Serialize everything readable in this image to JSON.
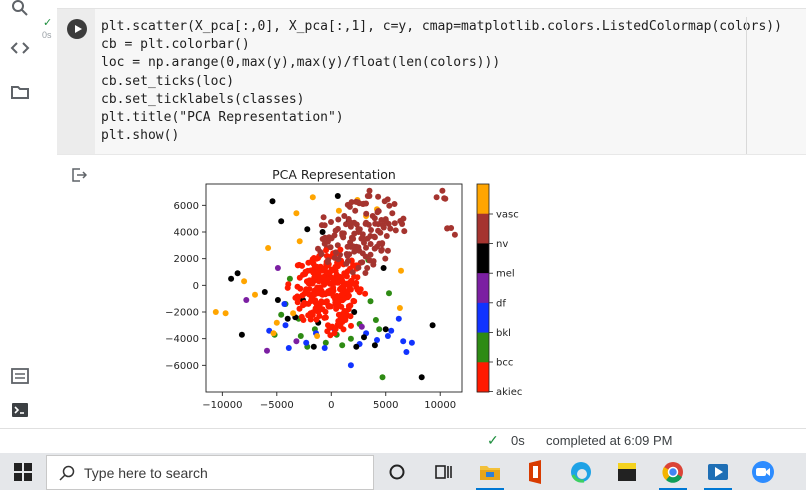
{
  "code_cell": {
    "exec_time": "0s",
    "lines": [
      "plt.scatter(X_pca[:,0], X_pca[:,1], c=y, cmap=matplotlib.colors.ListedColormap(colors))",
      "cb = plt.colorbar()",
      "loc = np.arange(0,max(y),max(y)/float(len(colors)))",
      "cb.set_ticks(loc)",
      "cb.set_ticklabels(classes)",
      "plt.title(\"PCA Representation\")",
      "plt.show()"
    ]
  },
  "status_bar": {
    "time": "0s",
    "message": "completed at 6:09 PM"
  },
  "taskbar": {
    "search_placeholder": "Type here to search",
    "apps": [
      "cortana-icon",
      "task-view-icon",
      "file-explorer-icon",
      "office-icon",
      "edge-icon",
      "sticky-notes-icon",
      "chrome-icon",
      "video-editor-icon",
      "zoom-icon"
    ]
  },
  "colors": {
    "akiec": "#ff1a00",
    "bcc": "#2e8b14",
    "bkl": "#1133ff",
    "df": "#7b1fa2",
    "mel": "#000000",
    "nv": "#a5342f",
    "vasc": "#ffa500"
  },
  "chart_data": {
    "type": "scatter",
    "title": "PCA Representation",
    "xlabel": "",
    "ylabel": "",
    "xlim": [
      -11500,
      12000
    ],
    "ylim": [
      -8000,
      7600
    ],
    "xticks": [
      "−10000",
      "−5000",
      "0",
      "5000",
      "10000"
    ],
    "xtick_values": [
      -10000,
      -5000,
      0,
      5000,
      10000
    ],
    "yticks": [
      "6000",
      "4000",
      "2000",
      "0",
      "−2000",
      "−4000",
      "−6000"
    ],
    "ytick_values": [
      6000,
      4000,
      2000,
      0,
      -2000,
      -4000,
      -6000
    ],
    "colorbar": {
      "labels": [
        "vasc",
        "nv",
        "mel",
        "df",
        "bkl",
        "bcc",
        "akiec"
      ],
      "colors": [
        "#ffa500",
        "#a5342f",
        "#000000",
        "#7b1fa2",
        "#1133ff",
        "#2e8b14",
        "#ff1a00"
      ]
    },
    "series": [
      {
        "name": "akiec",
        "points": [
          [
            -1500,
            -500
          ],
          [
            -600,
            300
          ],
          [
            -1200,
            800
          ],
          [
            -400,
            -1200
          ],
          [
            300,
            500
          ],
          [
            800,
            -300
          ],
          [
            1200,
            900
          ],
          [
            -2000,
            200
          ],
          [
            -800,
            -1800
          ],
          [
            500,
            -1500
          ],
          [
            1500,
            -800
          ],
          [
            -1800,
            -1000
          ],
          [
            -300,
            1500
          ],
          [
            900,
            1800
          ],
          [
            -1400,
            1200
          ],
          [
            200,
            -400
          ],
          [
            -2300,
            -300
          ],
          [
            1800,
            300
          ],
          [
            -900,
            -400
          ],
          [
            400,
            1100
          ],
          [
            -1100,
            -2300
          ],
          [
            2100,
            -1200
          ],
          [
            -2600,
            800
          ],
          [
            700,
            -2200
          ],
          [
            -300,
            -3000
          ],
          [
            1300,
            -2600
          ],
          [
            -1900,
            -2100
          ],
          [
            2400,
            600
          ],
          [
            -400,
            2200
          ],
          [
            1100,
            -200
          ],
          [
            -2100,
            1700
          ],
          [
            -700,
            600
          ],
          [
            600,
            200
          ],
          [
            -1600,
            -600
          ],
          [
            1600,
            -1800
          ],
          [
            -3100,
            -100
          ],
          [
            2700,
            -300
          ],
          [
            -200,
            -600
          ],
          [
            300,
            -900
          ],
          [
            -900,
            1300
          ],
          [
            2000,
            1500
          ],
          [
            -2600,
            -1500
          ]
        ]
      },
      {
        "name": "bcc",
        "points": [
          [
            -3000,
            -2500
          ],
          [
            -1500,
            -3300
          ],
          [
            500,
            -3700
          ],
          [
            2600,
            -2900
          ],
          [
            -4200,
            -1400
          ],
          [
            3600,
            -1200
          ],
          [
            -500,
            -4300
          ],
          [
            1800,
            -4000
          ],
          [
            -2800,
            -3800
          ],
          [
            4100,
            -2600
          ],
          [
            -3800,
            500
          ],
          [
            3400,
            1900
          ],
          [
            -5200,
            -3700
          ],
          [
            5300,
            -600
          ],
          [
            -2200,
            -4600
          ],
          [
            1000,
            -4500
          ],
          [
            -4600,
            -2200
          ],
          [
            4400,
            -3300
          ],
          [
            4700,
            -6900
          ]
        ]
      },
      {
        "name": "bkl",
        "points": [
          [
            -5700,
            -3400
          ],
          [
            -4200,
            -3000
          ],
          [
            3200,
            -3600
          ],
          [
            5500,
            -3400
          ],
          [
            6600,
            -4200
          ],
          [
            7400,
            -4300
          ],
          [
            1800,
            -6000
          ],
          [
            -3900,
            -4700
          ],
          [
            4200,
            -4100
          ],
          [
            -4300,
            -1400
          ],
          [
            6200,
            -2500
          ],
          [
            -600,
            -4700
          ],
          [
            2600,
            -4400
          ],
          [
            -2300,
            -4300
          ],
          [
            6900,
            -5000
          ],
          [
            5200,
            -3800
          ],
          [
            -1400,
            -3600
          ]
        ]
      },
      {
        "name": "df",
        "points": [
          [
            -5900,
            -4900
          ],
          [
            -7800,
            -1100
          ],
          [
            -4900,
            1300
          ],
          [
            300,
            -3300
          ],
          [
            -3200,
            -4200
          ],
          [
            2800,
            -3100
          ]
        ]
      },
      {
        "name": "mel",
        "points": [
          [
            -8200,
            -3700
          ],
          [
            -9200,
            500
          ],
          [
            -8600,
            900
          ],
          [
            -5400,
            6300
          ],
          [
            -4600,
            4800
          ],
          [
            -2200,
            4200
          ],
          [
            -800,
            4000
          ],
          [
            1600,
            4800
          ],
          [
            -4900,
            -1100
          ],
          [
            3000,
            -3900
          ],
          [
            5000,
            -3300
          ],
          [
            9300,
            -3000
          ],
          [
            8300,
            -6900
          ],
          [
            4000,
            -4500
          ],
          [
            -3300,
            -2400
          ],
          [
            -1200,
            -2800
          ],
          [
            2100,
            -2000
          ],
          [
            -2600,
            -1100
          ],
          [
            600,
            6700
          ],
          [
            -1600,
            -4600
          ],
          [
            2300,
            -4600
          ],
          [
            -4000,
            -2500
          ],
          [
            4800,
            1300
          ],
          [
            -6100,
            -500
          ]
        ]
      },
      {
        "name": "nv",
        "points": [
          [
            2000,
            3500
          ],
          [
            1500,
            2200
          ],
          [
            2500,
            4000
          ],
          [
            3000,
            3200
          ],
          [
            -400,
            2800
          ],
          [
            1000,
            3900
          ],
          [
            4300,
            4100
          ],
          [
            3800,
            5200
          ],
          [
            4900,
            6300
          ],
          [
            2200,
            5600
          ],
          [
            5600,
            5400
          ],
          [
            3200,
            4700
          ],
          [
            600,
            3000
          ],
          [
            2700,
            1700
          ],
          [
            4000,
            3600
          ],
          [
            10200,
            7100
          ],
          [
            11000,
            4300
          ],
          [
            5200,
            2600
          ],
          [
            3600,
            2300
          ],
          [
            1800,
            4400
          ],
          [
            4600,
            4900
          ],
          [
            -600,
            4500
          ],
          [
            2900,
            6100
          ],
          [
            1200,
            5200
          ],
          [
            3500,
            6700
          ],
          [
            6500,
            4600
          ],
          [
            800,
            2300
          ],
          [
            -200,
            3600
          ],
          [
            2300,
            2900
          ],
          [
            4200,
            2900
          ],
          [
            3300,
            1300
          ],
          [
            5100,
            3700
          ],
          [
            -1000,
            2500
          ]
        ]
      },
      {
        "name": "vasc",
        "points": [
          [
            -10600,
            -2000
          ],
          [
            -9700,
            -2100
          ],
          [
            -3200,
            5400
          ],
          [
            -1700,
            6600
          ],
          [
            700,
            5600
          ],
          [
            3200,
            5200
          ],
          [
            -7000,
            -700
          ],
          [
            -5800,
            2800
          ],
          [
            -3500,
            -2100
          ],
          [
            6400,
            1100
          ],
          [
            -8000,
            300
          ],
          [
            -5000,
            -2800
          ],
          [
            -1300,
            -3800
          ],
          [
            2400,
            6400
          ],
          [
            4200,
            5700
          ],
          [
            -5300,
            -3600
          ],
          [
            6300,
            -1700
          ],
          [
            -2900,
            3300
          ]
        ]
      }
    ]
  }
}
